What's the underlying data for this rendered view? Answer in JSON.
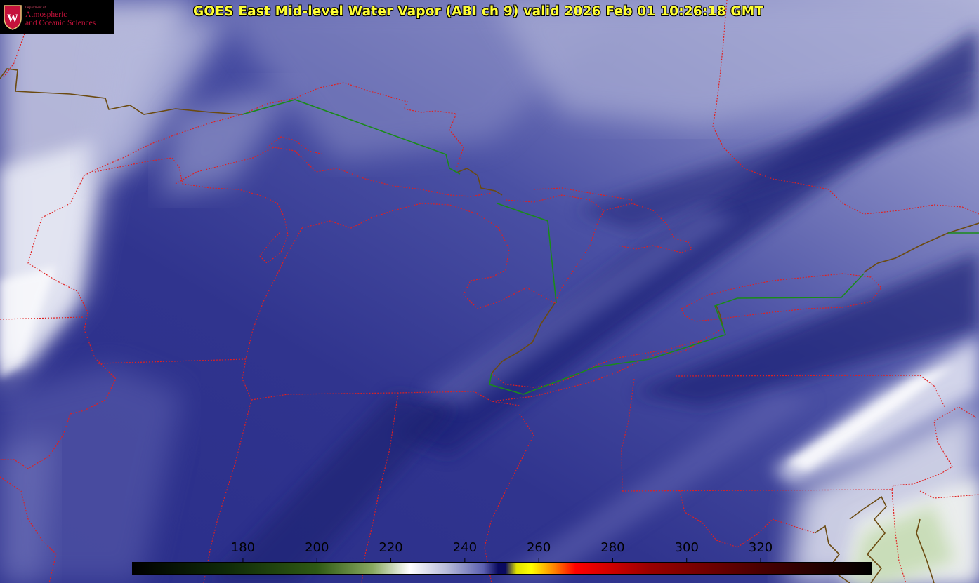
{
  "logo": {
    "line1": "Department of",
    "line2": "Atmospheric",
    "line3": "and Oceanic Sciences",
    "seal_letter": "W"
  },
  "title": "GOES East Mid-level Water Vapor (ABI ch 9)  valid 2026 Feb 01 10:26:18 GMT",
  "colorbar": {
    "min": 150,
    "max": 350,
    "ticks": [
      "180",
      "200",
      "220",
      "240",
      "260",
      "280",
      "300",
      "320"
    ],
    "tick_values": [
      180,
      200,
      220,
      240,
      260,
      280,
      300,
      320
    ],
    "stops": [
      {
        "v": 150,
        "c": "#000000"
      },
      {
        "v": 175,
        "c": "#0f2a08"
      },
      {
        "v": 200,
        "c": "#2f5a14"
      },
      {
        "v": 215,
        "c": "#88a860"
      },
      {
        "v": 225,
        "c": "#ffffff"
      },
      {
        "v": 235,
        "c": "#b8bcda"
      },
      {
        "v": 245,
        "c": "#5c60b0"
      },
      {
        "v": 249,
        "c": "#0a0a60"
      },
      {
        "v": 251,
        "c": "#0a0a60"
      },
      {
        "v": 254,
        "c": "#e0e000"
      },
      {
        "v": 258,
        "c": "#ffff00"
      },
      {
        "v": 264,
        "c": "#ff8800"
      },
      {
        "v": 270,
        "c": "#ff0000"
      },
      {
        "v": 290,
        "c": "#9a0000"
      },
      {
        "v": 320,
        "c": "#4a0000"
      },
      {
        "v": 350,
        "c": "#000000"
      }
    ]
  },
  "colors": {
    "state_borders": "#e02020",
    "intl_border": "#1a8a1a",
    "coastline": "#6b4a10",
    "title_text": "#ffff33"
  }
}
